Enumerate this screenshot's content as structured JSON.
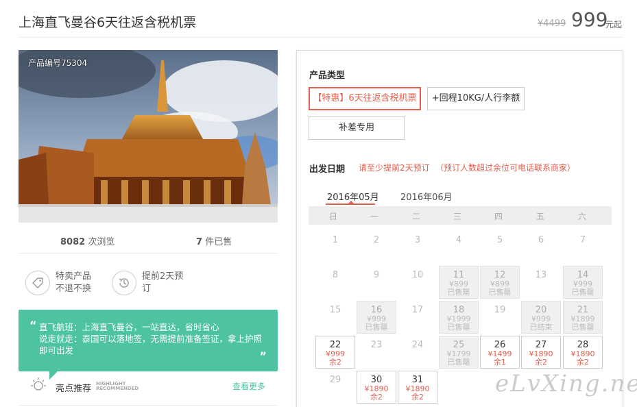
{
  "header": {
    "title": "上海直飞曼谷6天往返含税机票",
    "price_old": "¥4499",
    "price_new": "999",
    "price_unit": "元起"
  },
  "product": {
    "number_label": "产品编号75304",
    "views_count": "8082",
    "views_label": "次浏览",
    "sold_count": "7",
    "sold_label": "件已售"
  },
  "features": [
    {
      "line1": "特卖产品",
      "line2": "不退不换",
      "icon": "price-tag-icon"
    },
    {
      "line1": "提前2天预",
      "line2": "订",
      "icon": "history-clock-icon"
    }
  ],
  "promo": {
    "open_quote": "“",
    "text": "直飞航班：上海直飞曼谷，一站直达，省时省心\n说走就走：泰国可以落地签，无需提前准备签证，拿上护照即可出发",
    "close_quote": "”"
  },
  "highlight": {
    "title": "亮点推荐",
    "sub_line1": "HIGHLIGHT",
    "sub_line2": "RECOMMENDED",
    "more": "查看更多"
  },
  "panel": {
    "type_label": "产品类型",
    "options": [
      {
        "label": "【特惠】6天往返含税机票",
        "selected": true
      },
      {
        "label": "+回程10KG/人行李额",
        "selected": false
      },
      {
        "label": "补差专用",
        "selected": false
      }
    ],
    "date_label": "出发日期",
    "note1": "请至少提前2天预订",
    "note2": "（预订人数超过余位可电话联系商家）",
    "months": [
      "2016年05月",
      "2016年06月"
    ],
    "weekdays": [
      "日",
      "一",
      "二",
      "三",
      "四",
      "五",
      "六"
    ],
    "days": [
      {
        "day": "1",
        "status": "plain"
      },
      {
        "day": "2",
        "status": "plain"
      },
      {
        "day": "3",
        "status": "plain"
      },
      {
        "day": "4",
        "status": "plain"
      },
      {
        "day": "5",
        "status": "plain"
      },
      {
        "day": "6",
        "status": "plain"
      },
      {
        "day": "7",
        "status": "plain"
      },
      {
        "day": "8",
        "status": "plain"
      },
      {
        "day": "9",
        "status": "plain"
      },
      {
        "day": "10",
        "status": "plain"
      },
      {
        "day": "11",
        "status": "sold",
        "price": "¥899",
        "info": "已售罄"
      },
      {
        "day": "12",
        "status": "sold",
        "price": "¥899",
        "info": "已售罄"
      },
      {
        "day": "13",
        "status": "plain"
      },
      {
        "day": "14",
        "status": "sold",
        "price": "¥999",
        "info": "已售罄"
      },
      {
        "day": "15",
        "status": "plain"
      },
      {
        "day": "16",
        "status": "sold",
        "price": "¥999",
        "info": "已售罄"
      },
      {
        "day": "17",
        "status": "plain"
      },
      {
        "day": "18",
        "status": "sold",
        "price": "¥1999",
        "info": "已售罄"
      },
      {
        "day": "19",
        "status": "plain"
      },
      {
        "day": "20",
        "status": "sold",
        "price": "¥999",
        "info": "已结束"
      },
      {
        "day": "21",
        "status": "sold",
        "price": "¥1899",
        "info": "已售罄"
      },
      {
        "day": "22",
        "status": "avail",
        "price": "¥999",
        "info": "余2"
      },
      {
        "day": "23",
        "status": "plain"
      },
      {
        "day": "24",
        "status": "plain"
      },
      {
        "day": "25",
        "status": "sold",
        "price": "¥1799",
        "info": "已售罄"
      },
      {
        "day": "26",
        "status": "avail",
        "price": "¥1499",
        "info": "余1"
      },
      {
        "day": "27",
        "status": "avail",
        "price": "¥1890",
        "info": "余2"
      },
      {
        "day": "28",
        "status": "avail",
        "price": "¥1890",
        "info": "余2"
      },
      {
        "day": "29",
        "status": "plain"
      },
      {
        "day": "30",
        "status": "avail",
        "price": "¥1890",
        "info": "余2"
      },
      {
        "day": "31",
        "status": "avail",
        "price": "¥1890",
        "info": "余2"
      }
    ]
  },
  "watermark": "eLvXing.net",
  "colors": {
    "accent": "#e06050",
    "green": "#4dc3a2",
    "sold_bg": "#f0f0f0"
  }
}
